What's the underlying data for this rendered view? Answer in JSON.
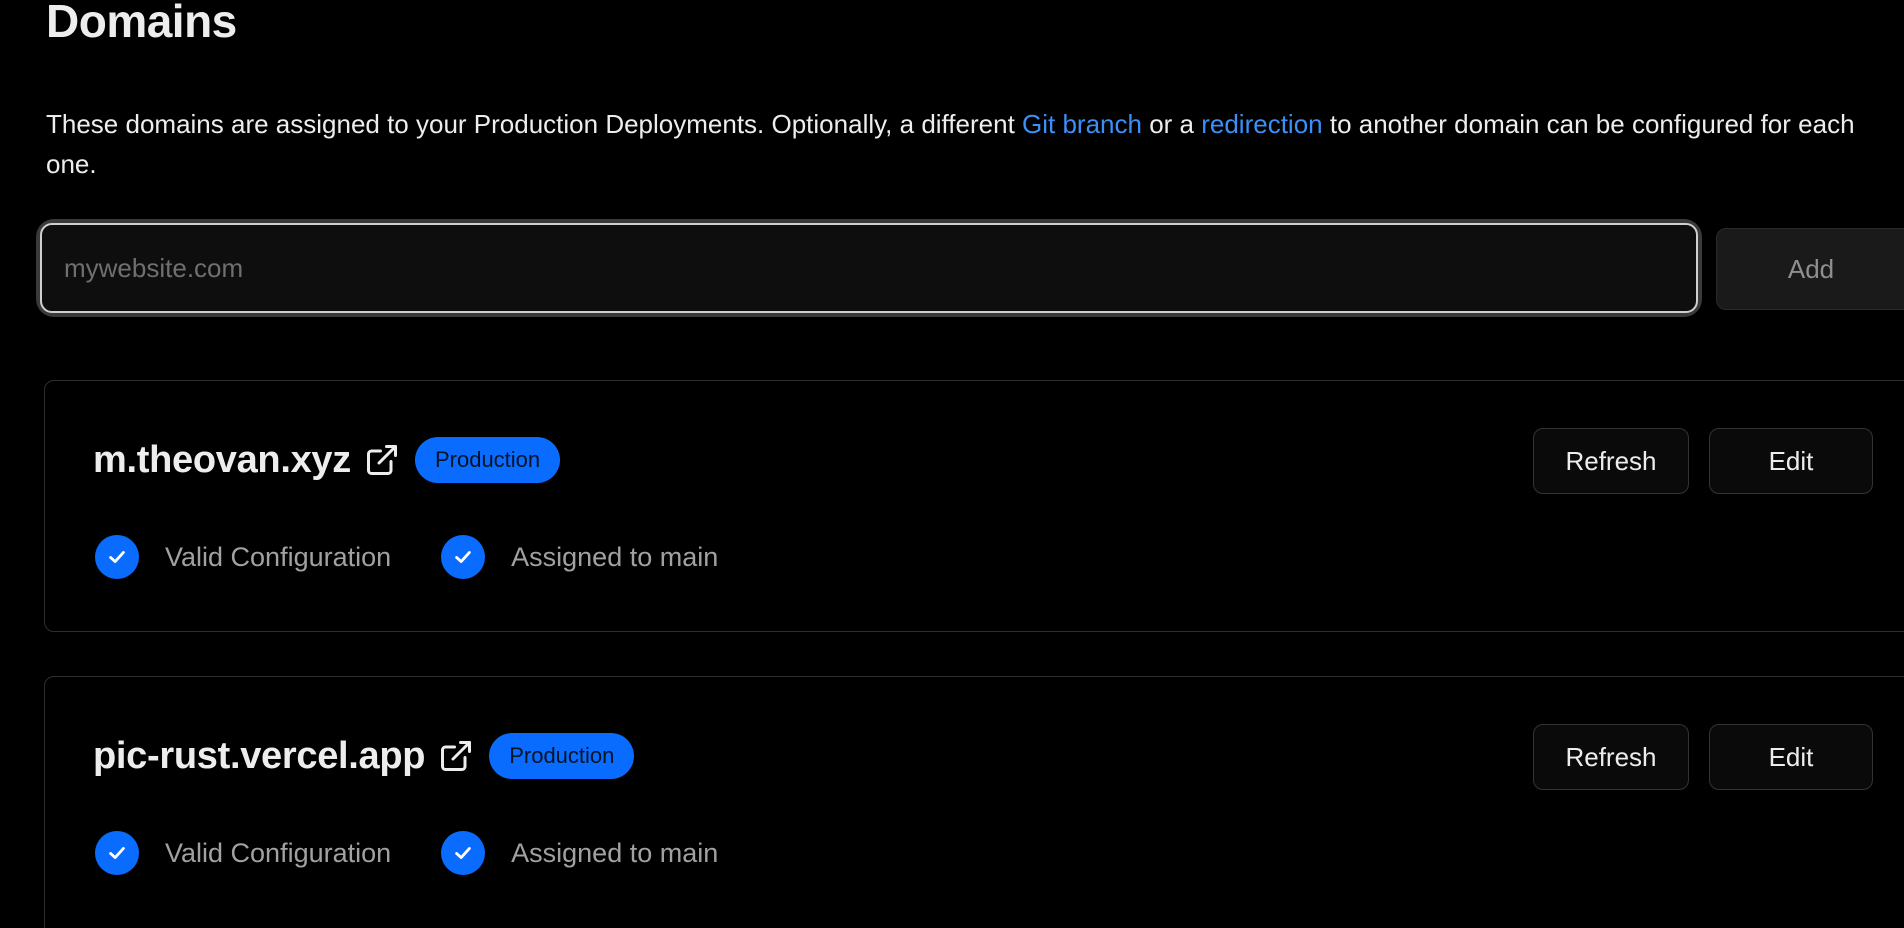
{
  "page": {
    "title": "Domains",
    "description": {
      "part1": "These domains are assigned to your Production Deployments. Optionally, a different ",
      "link1": "Git branch",
      "part2": " or a ",
      "link2": "redirection",
      "part3": " to another domain can be configured for each one."
    }
  },
  "add_domain": {
    "placeholder": "mywebsite.com",
    "value": "",
    "button_label": "Add"
  },
  "domains": [
    {
      "name": "m.theovan.xyz",
      "badge": "Production",
      "statuses": [
        "Valid Configuration",
        "Assigned to main"
      ],
      "refresh_label": "Refresh",
      "edit_label": "Edit"
    },
    {
      "name": "pic-rust.vercel.app",
      "badge": "Production",
      "statuses": [
        "Valid Configuration",
        "Assigned to main"
      ],
      "refresh_label": "Refresh",
      "edit_label": "Edit"
    }
  ],
  "icons": {
    "external": "external-link-icon",
    "status": "check-circle-icon"
  },
  "colors": {
    "background": "#000000",
    "accent": "#0a6cff",
    "link": "#3b8ff6",
    "muted_text": "#a1a1a1"
  }
}
